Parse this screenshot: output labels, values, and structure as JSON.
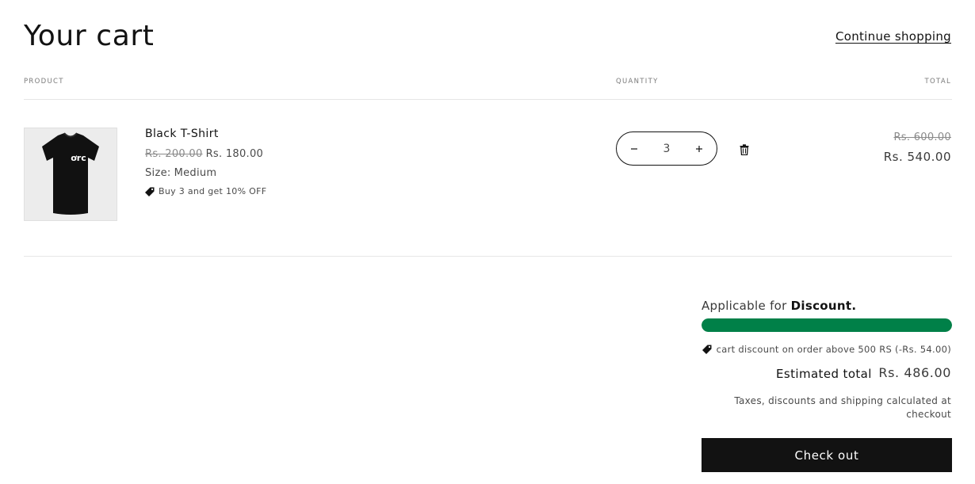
{
  "header": {
    "title": "Your cart",
    "continue_link": "Continue shopping"
  },
  "columns": {
    "product": "PRODUCT",
    "quantity": "QUANTITY",
    "total": "TOTAL"
  },
  "items": [
    {
      "name": "Black T-Shirt",
      "image_icon": "tshirt-icon",
      "image_logo_text": "ơrc",
      "price_original": "Rs. 200.00",
      "price_discounted": "Rs. 180.00",
      "option_label": "Size:",
      "option_value": "Medium",
      "promo_icon": "tag-icon",
      "promo_text": "Buy 3 and get 10% OFF",
      "quantity": "3",
      "decrease_icon": "minus-icon",
      "increase_icon": "plus-icon",
      "remove_icon": "trash-icon",
      "total_original": "Rs. 600.00",
      "total_discounted": "Rs. 540.00"
    }
  ],
  "summary": {
    "discount_prefix": "Applicable for",
    "discount_bold": "Discount.",
    "progress_fraction": 1.0,
    "cart_discount_icon": "tag-icon",
    "cart_discount_text": "cart discount on order above 500 RS (-Rs. 54.00)",
    "estimated_total_label": "Estimated total",
    "estimated_total_value": "Rs. 486.00",
    "tax_note": "Taxes, discounts and shipping calculated at checkout",
    "checkout_label": "Check out"
  },
  "colors": {
    "progress_fill": "#008048",
    "checkout_bg": "#121212",
    "text": "#121212"
  }
}
